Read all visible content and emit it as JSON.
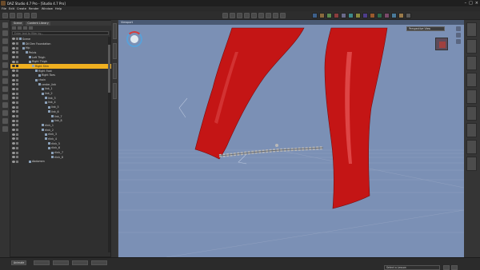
{
  "window": {
    "title": "DAZ Studio 4.7 Pro - [Studio 4.7 Pro]",
    "controls": [
      "–",
      "□",
      "×"
    ]
  },
  "menu": [
    "File",
    "Edit",
    "Create",
    "Render",
    "Window",
    "Help"
  ],
  "scene_panel": {
    "tabs": [
      "Scene",
      "Content Library"
    ],
    "search_placeholder": "Enter text to filter by..."
  },
  "tree": [
    {
      "label": "Scene",
      "depth": 0
    },
    {
      "label": "Dil Den Foundation",
      "depth": 1
    },
    {
      "label": "Hip",
      "depth": 1
    },
    {
      "label": "Pelvis",
      "depth": 2
    },
    {
      "label": "Left Thigh",
      "depth": 3
    },
    {
      "label": "Right Thigh",
      "depth": 3
    },
    {
      "label": "Right Shin",
      "depth": 4,
      "selected": true
    },
    {
      "label": "Right Foot",
      "depth": 5
    },
    {
      "label": "Right Toes",
      "depth": 6
    },
    {
      "label": "chain",
      "depth": 5
    },
    {
      "label": "center_link",
      "depth": 6
    },
    {
      "label": "link_1",
      "depth": 7
    },
    {
      "label": "link_2",
      "depth": 7
    },
    {
      "label": "link_3",
      "depth": 8
    },
    {
      "label": "link_4",
      "depth": 8
    },
    {
      "label": "link_5",
      "depth": 9
    },
    {
      "label": "link_6",
      "depth": 9
    },
    {
      "label": "link_7",
      "depth": 10
    },
    {
      "label": "link_8",
      "depth": 10
    },
    {
      "label": "rlink_1",
      "depth": 7
    },
    {
      "label": "rlink_2",
      "depth": 7
    },
    {
      "label": "rlink_3",
      "depth": 8
    },
    {
      "label": "rlink_4",
      "depth": 8
    },
    {
      "label": "rlink_5",
      "depth": 9
    },
    {
      "label": "rlink_6",
      "depth": 9
    },
    {
      "label": "rlink_7",
      "depth": 10
    },
    {
      "label": "rlink_8",
      "depth": 10
    },
    {
      "label": "Abdomen",
      "depth": 3
    }
  ],
  "viewport": {
    "label": "Viewport",
    "camera": "Perspective View",
    "background": "#7b90b5",
    "object_color": "#c41515",
    "chain_color": "#b8b8b8"
  },
  "bottom": {
    "tabs": [
      "Animate",
      "",
      "",
      "",
      ""
    ],
    "lessons": "Select a Lesson"
  }
}
